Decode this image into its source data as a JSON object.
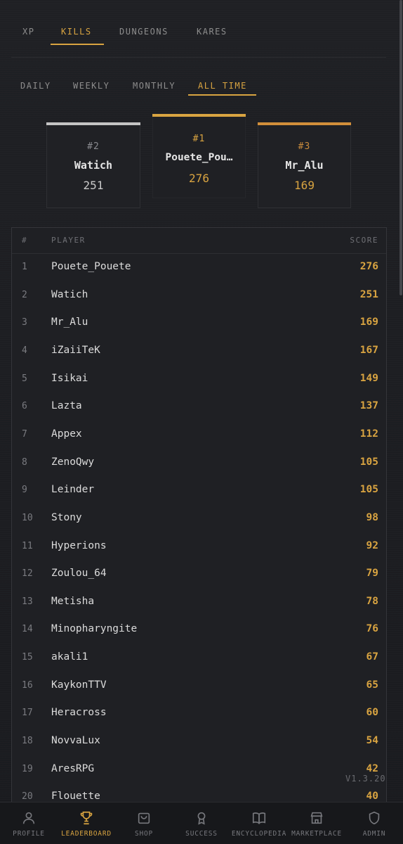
{
  "category_tabs": [
    {
      "label": "XP",
      "active": false
    },
    {
      "label": "KILLS",
      "active": true
    },
    {
      "label": "DUNGEONS",
      "active": false
    },
    {
      "label": "KARES",
      "active": false
    }
  ],
  "period_tabs": [
    {
      "label": "DAILY",
      "active": false
    },
    {
      "label": "WEEKLY",
      "active": false
    },
    {
      "label": "MONTHLY",
      "active": false
    },
    {
      "label": "ALL TIME",
      "active": true
    }
  ],
  "podium": {
    "first": {
      "rank": "#1",
      "name": "Pouete_Pou…",
      "score": "276"
    },
    "second": {
      "rank": "#2",
      "name": "Watich",
      "score": "251"
    },
    "third": {
      "rank": "#3",
      "name": "Mr_Alu",
      "score": "169"
    }
  },
  "table": {
    "headers": {
      "rank": "#",
      "player": "PLAYER",
      "score": "SCORE"
    },
    "rows": [
      {
        "rank": "1",
        "player": "Pouete_Pouete",
        "score": "276"
      },
      {
        "rank": "2",
        "player": "Watich",
        "score": "251"
      },
      {
        "rank": "3",
        "player": "Mr_Alu",
        "score": "169"
      },
      {
        "rank": "4",
        "player": "iZaiiTeK",
        "score": "167"
      },
      {
        "rank": "5",
        "player": "Isikai",
        "score": "149"
      },
      {
        "rank": "6",
        "player": "Lazta",
        "score": "137"
      },
      {
        "rank": "7",
        "player": "Appex",
        "score": "112"
      },
      {
        "rank": "8",
        "player": "ZenoQwy",
        "score": "105"
      },
      {
        "rank": "9",
        "player": "Leinder",
        "score": "105"
      },
      {
        "rank": "10",
        "player": "Stony",
        "score": "98"
      },
      {
        "rank": "11",
        "player": "Hyperions",
        "score": "92"
      },
      {
        "rank": "12",
        "player": "Zoulou_64",
        "score": "79"
      },
      {
        "rank": "13",
        "player": "Metisha",
        "score": "78"
      },
      {
        "rank": "14",
        "player": "Minopharyngite",
        "score": "76"
      },
      {
        "rank": "15",
        "player": "akali1",
        "score": "67"
      },
      {
        "rank": "16",
        "player": "KaykonTTV",
        "score": "65"
      },
      {
        "rank": "17",
        "player": "Heracross",
        "score": "60"
      },
      {
        "rank": "18",
        "player": "NovvaLux",
        "score": "54"
      },
      {
        "rank": "19",
        "player": "AresRPG",
        "score": "42"
      },
      {
        "rank": "20",
        "player": "Flouette",
        "score": "40"
      }
    ]
  },
  "version": "V1.3.20",
  "bottom_nav": [
    {
      "label": "PROFILE",
      "icon": "user-icon",
      "active": false
    },
    {
      "label": "LEADERBOARD",
      "icon": "trophy-icon",
      "active": true
    },
    {
      "label": "SHOP",
      "icon": "shopping-bag-icon",
      "active": false
    },
    {
      "label": "SUCCESS",
      "icon": "medal-icon",
      "active": false
    },
    {
      "label": "ENCYCLOPEDIA",
      "icon": "book-icon",
      "active": false
    },
    {
      "label": "MARKETPLACE",
      "icon": "store-icon",
      "active": false
    },
    {
      "label": "ADMIN",
      "icon": "shield-icon",
      "active": false
    }
  ],
  "colors": {
    "accent": "#d9a441",
    "background": "#1c1d21",
    "silver": "#c4c4c4",
    "bronze": "#d28f3a"
  }
}
